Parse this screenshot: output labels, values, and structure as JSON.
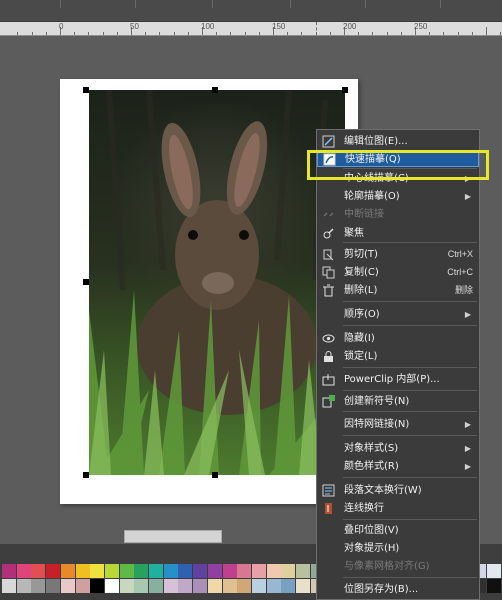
{
  "ruler": {
    "ticks": [
      "0",
      "50",
      "100",
      "150",
      "200",
      "250"
    ]
  },
  "context_menu": {
    "items": [
      {
        "label": "编辑位图(E)...",
        "icon": "edit-bitmap-icon",
        "arrow": false,
        "disabled": false,
        "highlight": false,
        "shortcut": ""
      },
      {
        "label": "快速描摹(Q)",
        "icon": "quick-trace-icon",
        "arrow": false,
        "disabled": false,
        "highlight": true,
        "shortcut": ""
      },
      {
        "label": "中心线描摹(C)",
        "icon": "",
        "arrow": true,
        "disabled": false,
        "highlight": false,
        "shortcut": ""
      },
      {
        "label": "轮廓描摹(O)",
        "icon": "",
        "arrow": true,
        "disabled": false,
        "highlight": false,
        "shortcut": ""
      },
      {
        "label": "中断链接",
        "icon": "break-link-icon",
        "arrow": false,
        "disabled": true,
        "highlight": false,
        "shortcut": ""
      },
      {
        "label": "聚焦",
        "icon": "focus-icon",
        "arrow": false,
        "disabled": false,
        "highlight": false,
        "shortcut": ""
      },
      {
        "label": "剪切(T)",
        "icon": "cut-icon",
        "arrow": false,
        "disabled": false,
        "highlight": false,
        "shortcut": "Ctrl+X"
      },
      {
        "label": "复制(C)",
        "icon": "copy-icon",
        "arrow": false,
        "disabled": false,
        "highlight": false,
        "shortcut": "Ctrl+C"
      },
      {
        "label": "删除(L)",
        "icon": "trash-icon",
        "arrow": false,
        "disabled": false,
        "highlight": false,
        "shortcut": "删除"
      },
      {
        "label": "顺序(O)",
        "icon": "",
        "arrow": true,
        "disabled": false,
        "highlight": false,
        "shortcut": ""
      },
      {
        "label": "隐藏(I)",
        "icon": "eye-icon",
        "arrow": false,
        "disabled": false,
        "highlight": false,
        "shortcut": ""
      },
      {
        "label": "锁定(L)",
        "icon": "lock-icon",
        "arrow": false,
        "disabled": false,
        "highlight": false,
        "shortcut": ""
      },
      {
        "label": "PowerClip 内部(P)...",
        "icon": "powerclip-icon",
        "arrow": false,
        "disabled": false,
        "highlight": false,
        "shortcut": ""
      },
      {
        "label": "创建新符号(N)",
        "icon": "new-symbol-icon",
        "arrow": false,
        "disabled": false,
        "highlight": false,
        "shortcut": ""
      },
      {
        "label": "因特网链接(N)",
        "icon": "",
        "arrow": true,
        "disabled": false,
        "highlight": false,
        "shortcut": ""
      },
      {
        "label": "对象样式(S)",
        "icon": "",
        "arrow": true,
        "disabled": false,
        "highlight": false,
        "shortcut": ""
      },
      {
        "label": "颜色样式(R)",
        "icon": "",
        "arrow": true,
        "disabled": false,
        "highlight": false,
        "shortcut": ""
      },
      {
        "label": "段落文本换行(W)",
        "icon": "text-wrap-icon",
        "arrow": false,
        "disabled": false,
        "highlight": false,
        "shortcut": ""
      },
      {
        "label": "连线换行",
        "icon": "connector-wrap-icon",
        "arrow": false,
        "disabled": false,
        "highlight": false,
        "shortcut": ""
      },
      {
        "label": "叠印位图(V)",
        "icon": "",
        "arrow": false,
        "disabled": false,
        "highlight": false,
        "shortcut": ""
      },
      {
        "label": "对象提示(H)",
        "icon": "",
        "arrow": false,
        "disabled": false,
        "highlight": false,
        "shortcut": ""
      },
      {
        "label": "与像素网格对齐(G)",
        "icon": "",
        "arrow": false,
        "disabled": true,
        "highlight": false,
        "shortcut": ""
      },
      {
        "label": "位图另存为(B)...",
        "icon": "",
        "arrow": false,
        "disabled": false,
        "highlight": false,
        "shortcut": ""
      }
    ]
  },
  "palette": {
    "row1": [
      "#b0307a",
      "#e0447a",
      "#e05050",
      "#c8202a",
      "#e88a2a",
      "#f0c020",
      "#f0e040",
      "#b8d838",
      "#60b848",
      "#28a060",
      "#20b0a0",
      "#2890c8",
      "#3060b0",
      "#6040a0",
      "#9040a0",
      "#c04090",
      "#d87890",
      "#e8a0a8",
      "#f0c8b0",
      "#e0d0a0",
      "#b8c0a0",
      "#90a8a0",
      "#8090a8",
      "#a090b0",
      "#c0a0c0",
      "#d8c0d0",
      "#f0e0e8",
      "#c8c8c8",
      "#808080",
      "#404040",
      "#202020",
      "#b0b8d8",
      "#d0d8e8",
      "#e0e8f0"
    ],
    "row2": [
      "#d8d8d8",
      "#b8b8b8",
      "#989898",
      "#787878",
      "#e8c8c8",
      "#d0a0a0",
      "#000000",
      "#ffffff",
      "#c8d8c0",
      "#a8c8b0",
      "#88b0a0",
      "#d8c0d8",
      "#c0a8c8",
      "#a890b8",
      "#f0d8a8",
      "#e0c090",
      "#d0a878",
      "#b8d0e0",
      "#98b8d0",
      "#78a0c0",
      "#e8e0c8",
      "#d0c8b0",
      "#b8b098",
      "#a8c0a0",
      "#90a888",
      "#789070",
      "#f0f0f0",
      "#e0e0e0",
      "#c0c0c0",
      "#a0a0a0",
      "#707070",
      "#505050",
      "#303030",
      "#101010"
    ]
  }
}
